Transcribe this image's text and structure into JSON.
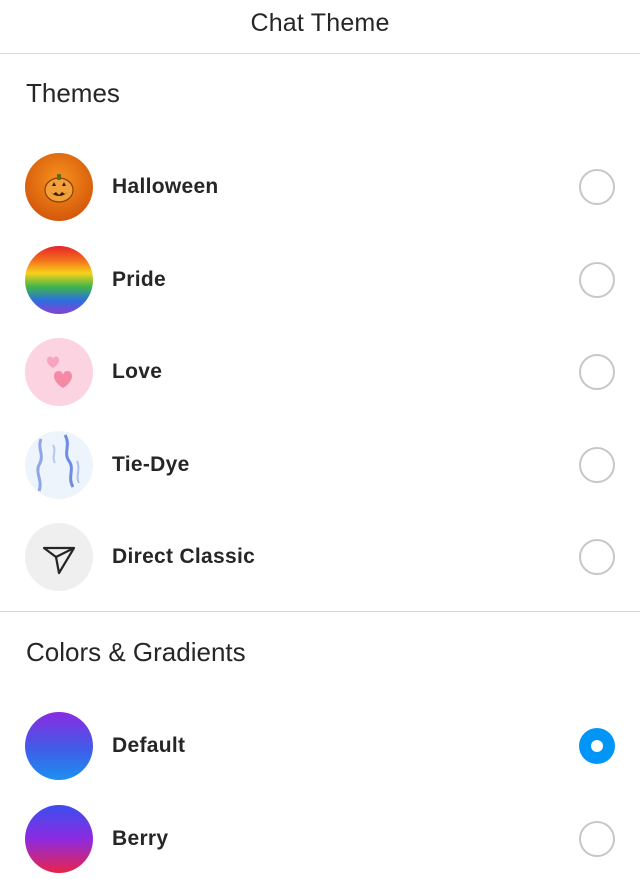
{
  "header": {
    "title": "Chat Theme"
  },
  "sections": {
    "themes": {
      "title": "Themes",
      "items": [
        {
          "label": "Halloween",
          "icon": "pumpkin-icon",
          "selected": false
        },
        {
          "label": "Pride",
          "icon": "rainbow-icon",
          "selected": false
        },
        {
          "label": "Love",
          "icon": "hearts-icon",
          "selected": false
        },
        {
          "label": "Tie-Dye",
          "icon": "tie-dye-icon",
          "selected": false
        },
        {
          "label": "Direct Classic",
          "icon": "paper-plane-icon",
          "selected": false
        }
      ]
    },
    "colors": {
      "title": "Colors & Gradients",
      "items": [
        {
          "label": "Default",
          "icon": "gradient-purple-blue-icon",
          "selected": true
        },
        {
          "label": "Berry",
          "icon": "gradient-blue-red-icon",
          "selected": false
        }
      ]
    }
  },
  "colors": {
    "accent": "#0095f6",
    "text": "#262626",
    "divider": "#d9d9d9",
    "radio_border": "#c7c7c7"
  }
}
